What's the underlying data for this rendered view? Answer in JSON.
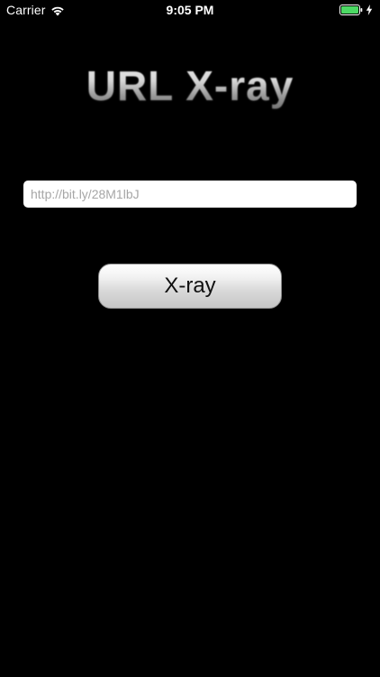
{
  "status_bar": {
    "carrier": "Carrier",
    "time": "9:05 PM",
    "battery_color": "#4cd964"
  },
  "app": {
    "title": "URL X-ray"
  },
  "url_field": {
    "placeholder": "http://bit.ly/28M1lbJ",
    "value": ""
  },
  "xray_button": {
    "label": "X-ray"
  },
  "icons": {
    "wifi": "wifi-icon",
    "battery": "battery-icon",
    "charging": "bolt-icon"
  }
}
